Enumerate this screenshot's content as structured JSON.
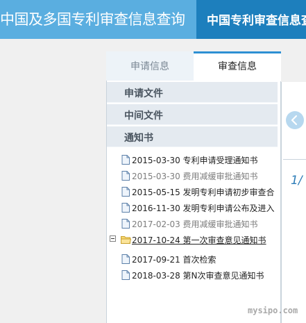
{
  "header": {
    "title": "中国及多国专利审查信息查询",
    "nav_label": "中国专利审查信息查询"
  },
  "tabs": [
    {
      "label": "申请信息",
      "active": false
    },
    {
      "label": "审查信息",
      "active": true
    }
  ],
  "sections": [
    {
      "label": "申请文件"
    },
    {
      "label": "中间文件"
    },
    {
      "label": "通知书"
    }
  ],
  "documents": [
    {
      "text": "2015-03-30 专利申请受理通知书",
      "state": "normal",
      "icon": "document-icon"
    },
    {
      "text": "2015-03-30 费用减缓审批通知书",
      "state": "muted",
      "icon": "document-icon"
    },
    {
      "text": "2015-05-15 发明专利申请初步审查合",
      "state": "normal",
      "icon": "document-icon"
    },
    {
      "text": "2016-11-30 发明专利申请公布及进入",
      "state": "normal",
      "icon": "document-icon"
    },
    {
      "text": "2017-02-03 费用减缓审批通知书",
      "state": "muted",
      "icon": "document-icon"
    },
    {
      "text": "2017-10-24 第一次审查意见通知书",
      "state": "selected",
      "icon": "folder-icon",
      "expandable": true
    },
    {
      "text": "2017-09-21 首次检索",
      "state": "normal",
      "icon": "document-icon"
    },
    {
      "text": "2018-03-28 第N次审查意见通知书",
      "state": "normal",
      "icon": "document-icon"
    }
  ],
  "viewer": {
    "prev_icon": "chevron-left-icon",
    "page_indicator": "1/"
  },
  "watermark": "mysipo.com",
  "colors": {
    "banner": "#5aaee0",
    "banner_nav": "#1d7fbd",
    "tab_accent": "#2d8fd3",
    "section_bg": "#e4eaf0"
  }
}
